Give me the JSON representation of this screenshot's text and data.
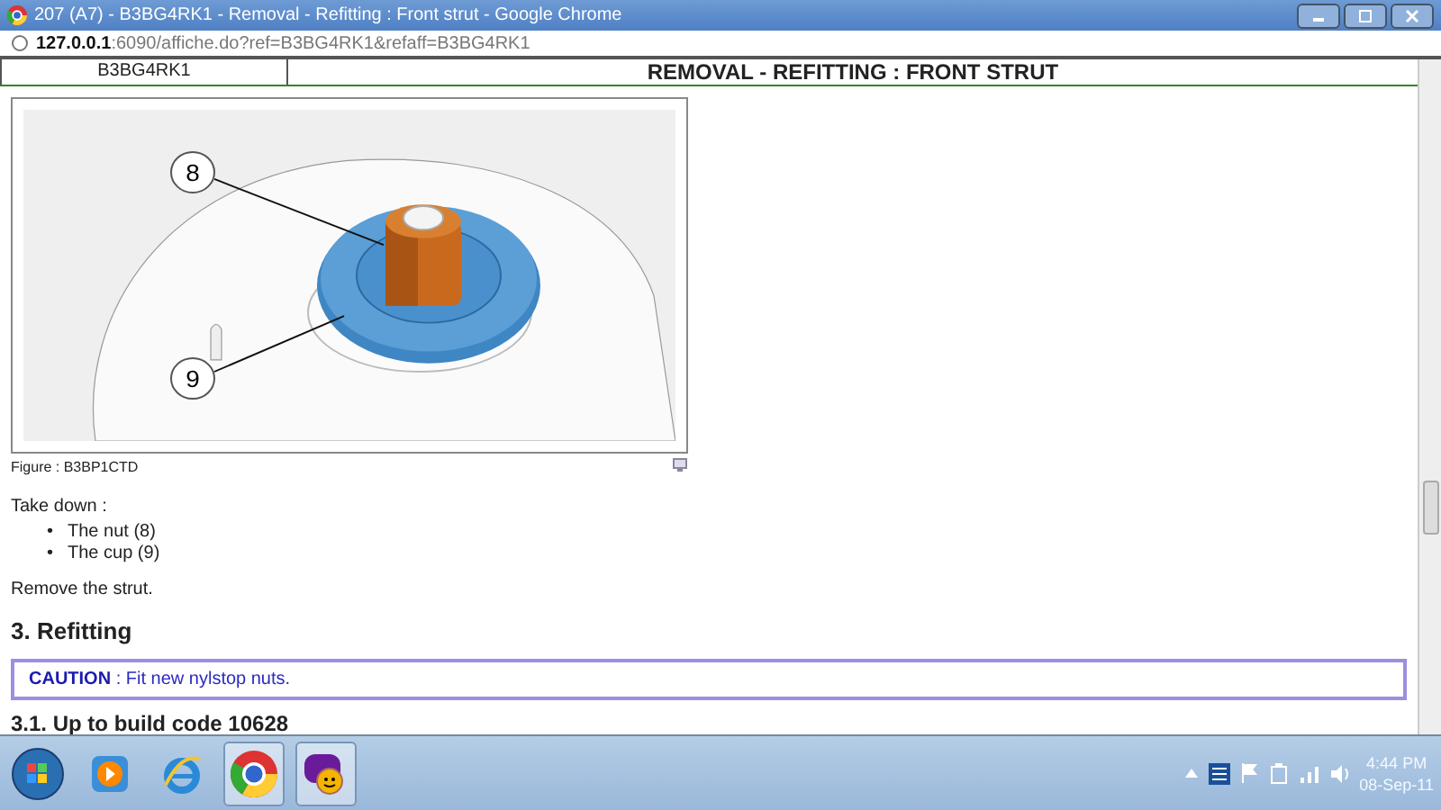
{
  "window": {
    "title": "207 (A7) - B3BG4RK1 - Removal - Refitting : Front strut - Google Chrome"
  },
  "address_bar": {
    "host": "127.0.0.1",
    "path": ":6090/affiche.do?ref=B3BG4RK1&refaff=B3BG4RK1"
  },
  "header": {
    "reference": "B3BG4RK1",
    "title": "REMOVAL - REFITTING : FRONT STRUT"
  },
  "figure": {
    "callouts": [
      "8",
      "9"
    ],
    "caption": "Figure : B3BP1CTD"
  },
  "steps": {
    "intro": "Take down :",
    "bullet": "•",
    "items": [
      "The nut (8)",
      "The cup (9)"
    ],
    "after": "Remove the strut."
  },
  "section": {
    "heading": "3. Refitting"
  },
  "caution": {
    "label": "CAUTION",
    "text": " : Fit new nylstop nuts."
  },
  "subsection": {
    "heading": "3.1. Up to build code 10628"
  },
  "taskbar": {
    "apps": [
      {
        "kind": "media",
        "selected": false
      },
      {
        "kind": "ie",
        "selected": false
      },
      {
        "kind": "chrome",
        "selected": true
      },
      {
        "kind": "messenger",
        "selected": true
      }
    ],
    "time": "4:44 PM",
    "date": "08-Sep-11"
  }
}
